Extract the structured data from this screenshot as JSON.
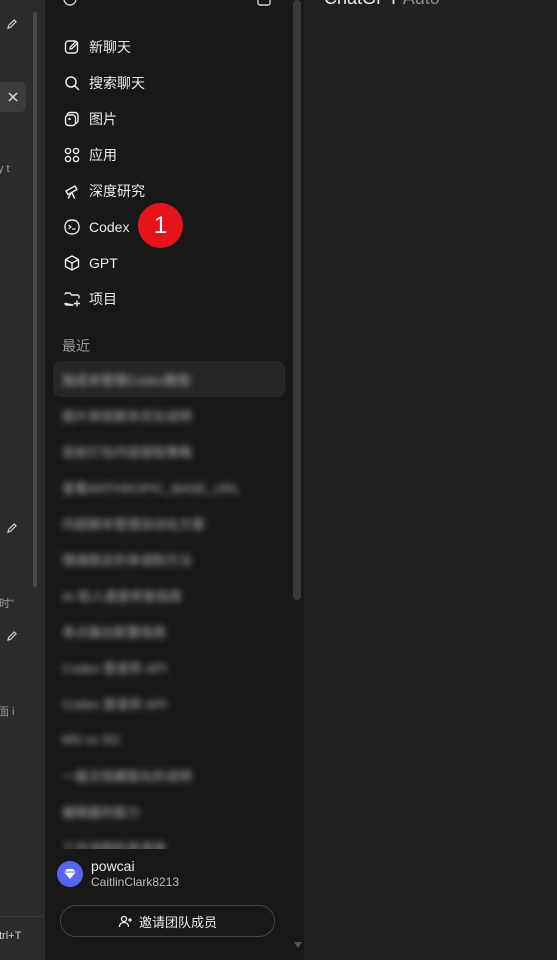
{
  "left_panel": {
    "fragments": [
      "y t",
      "时\"",
      "面 i",
      "trl+T"
    ]
  },
  "sidebar": {
    "nav": [
      {
        "label": "新聊天",
        "icon": "new-chat-icon"
      },
      {
        "label": "搜索聊天",
        "icon": "search-icon"
      },
      {
        "label": "图片",
        "icon": "images-icon"
      },
      {
        "label": "应用",
        "icon": "apps-icon"
      },
      {
        "label": "深度研究",
        "icon": "telescope-icon"
      },
      {
        "label": "Codex",
        "icon": "codex-icon"
      },
      {
        "label": "GPT",
        "icon": "cube-icon"
      },
      {
        "label": "项目",
        "icon": "folder-plus-icon"
      }
    ],
    "annotation_badge": "1",
    "recent_title": "最近",
    "recent": [
      "独成本管理Codex教程",
      "图片审核脚本优化说明",
      "目前打包内容提取策略",
      "查看ANTHROPIC_BASE_URL",
      "内部脚本管理自动化方案",
      "情绪稳定的单调制方法",
      "AI 助人速度修复指南",
      "单点输出配置指南",
      "Codex 登录异 API",
      "Codex 登录异 API",
      "MS vs SG",
      "一篇文档模板化的说明",
      "编辑器的能力",
      "工作流程检查清单"
    ],
    "profile": {
      "name": "powcai",
      "id": "CaitlinClark8213"
    },
    "invite_label": "邀请团队成员"
  },
  "main": {
    "model_name": "ChatGPT",
    "model_variant": "Auto"
  },
  "colors": {
    "sidebar_bg": "#181818",
    "main_bg": "#212121",
    "badge": "#e5141b",
    "avatar": "#5865f2"
  }
}
